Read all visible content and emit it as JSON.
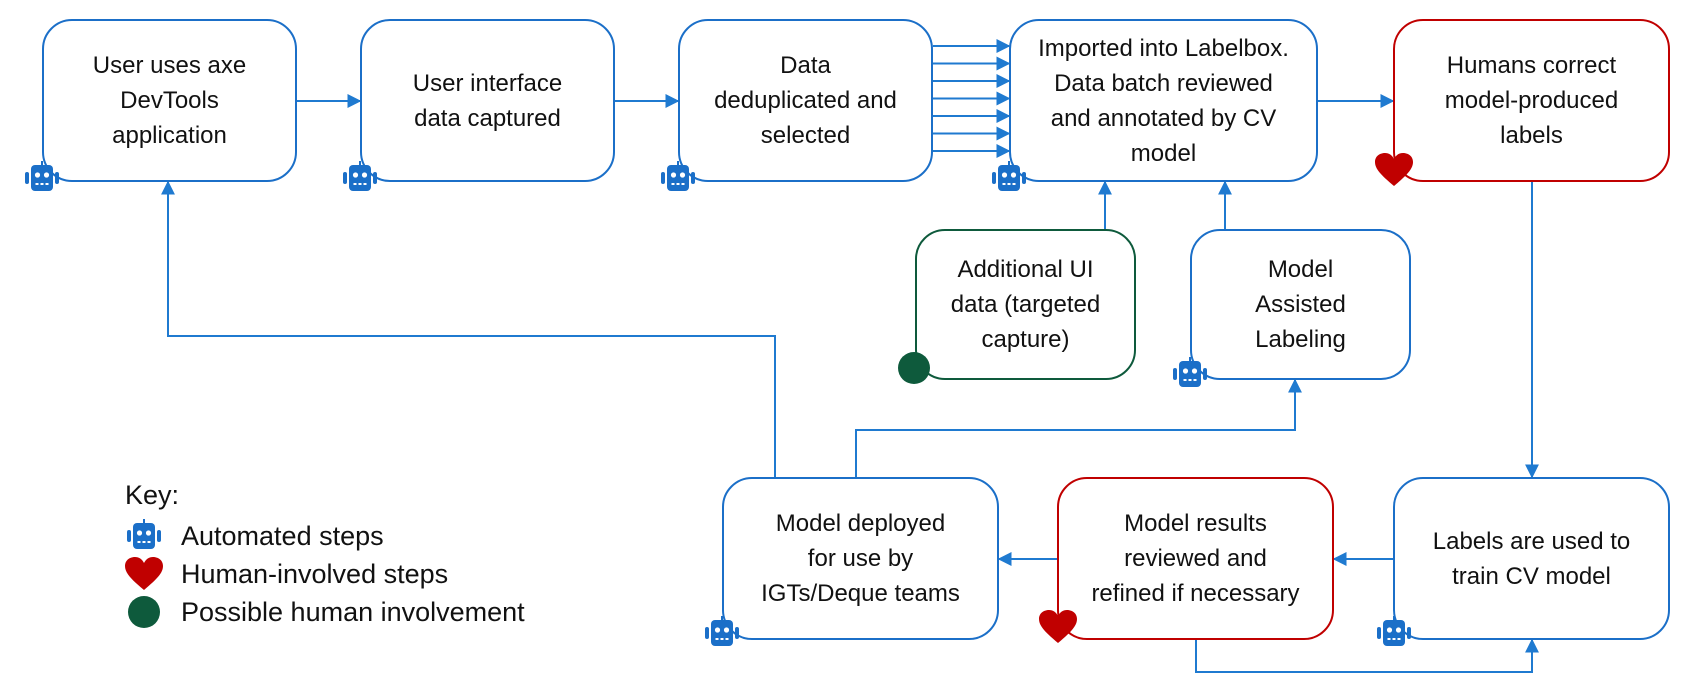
{
  "colors": {
    "automated": "#1b6fc8",
    "human": "#c00000",
    "possible": "#0e5a3c",
    "connector": "#1f7ad0"
  },
  "nodes": [
    {
      "id": "user-uses-axe",
      "label": "User uses axe\nDevTools\napplication",
      "type": "automated"
    },
    {
      "id": "ui-data-captured",
      "label": "User interface\ndata captured",
      "type": "automated"
    },
    {
      "id": "data-deduplicated",
      "label": "Data\ndeduplicated and\nselected",
      "type": "automated"
    },
    {
      "id": "imported-labelbox",
      "label": "Imported into Labelbox.\nData batch reviewed\nand annotated by CV\nmodel",
      "type": "automated"
    },
    {
      "id": "humans-correct",
      "label": "Humans correct\nmodel-produced\nlabels",
      "type": "human"
    },
    {
      "id": "additional-ui-data",
      "label": "Additional UI\ndata (targeted\ncapture)",
      "type": "possible"
    },
    {
      "id": "model-assisted-labeling",
      "label": "Model\nAssisted\nLabeling",
      "type": "automated"
    },
    {
      "id": "labels-train-model",
      "label": "Labels are used  to\ntrain CV model",
      "type": "automated"
    },
    {
      "id": "results-reviewed",
      "label": "Model results\nreviewed and\nrefined if necessary",
      "type": "human"
    },
    {
      "id": "model-deployed",
      "label": "Model deployed\nfor use by\nIGTs/Deque teams",
      "type": "automated"
    }
  ],
  "edges": [
    {
      "from": "user-uses-axe",
      "to": "ui-data-captured"
    },
    {
      "from": "ui-data-captured",
      "to": "data-deduplicated"
    },
    {
      "from": "data-deduplicated",
      "to": "imported-labelbox",
      "parallel_arrows": 7
    },
    {
      "from": "imported-labelbox",
      "to": "humans-correct"
    },
    {
      "from": "additional-ui-data",
      "to": "imported-labelbox"
    },
    {
      "from": "model-assisted-labeling",
      "to": "imported-labelbox"
    },
    {
      "from": "humans-correct",
      "to": "labels-train-model"
    },
    {
      "from": "labels-train-model",
      "to": "results-reviewed"
    },
    {
      "from": "results-reviewed",
      "to": "model-deployed"
    },
    {
      "from": "results-reviewed",
      "to": "labels-train-model"
    },
    {
      "from": "model-deployed",
      "to": "user-uses-axe"
    },
    {
      "from": "model-deployed",
      "to": "model-assisted-labeling"
    }
  ],
  "legend": {
    "title": "Key:",
    "items": [
      {
        "icon": "robot-icon",
        "label": "Automated steps"
      },
      {
        "icon": "heart-icon",
        "label": "Human-involved steps"
      },
      {
        "icon": "green-circle-icon",
        "label": "Possible human involvement"
      }
    ]
  }
}
